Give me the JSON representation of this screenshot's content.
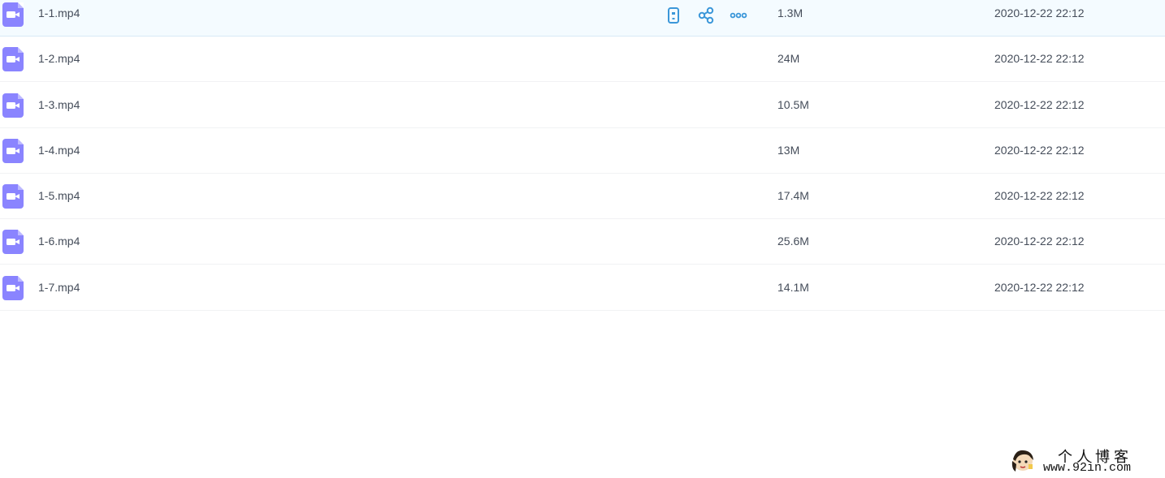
{
  "files": [
    {
      "name": "1-1.mp4",
      "size": "1.3M",
      "date": "2020-12-22 22:12"
    },
    {
      "name": "1-2.mp4",
      "size": "24M",
      "date": "2020-12-22 22:12"
    },
    {
      "name": "1-3.mp4",
      "size": "10.5M",
      "date": "2020-12-22 22:12"
    },
    {
      "name": "1-4.mp4",
      "size": "13M",
      "date": "2020-12-22 22:12"
    },
    {
      "name": "1-5.mp4",
      "size": "17.4M",
      "date": "2020-12-22 22:12"
    },
    {
      "name": "1-6.mp4",
      "size": "25.6M",
      "date": "2020-12-22 22:12"
    },
    {
      "name": "1-7.mp4",
      "size": "14.1M",
      "date": "2020-12-22 22:12"
    }
  ],
  "hover_actions": [
    "phone-icon",
    "share-icon",
    "more-icon"
  ],
  "file_icon": "video-file-icon",
  "colors": {
    "accent": "#3b97d9",
    "video_icon": "#8a84ff",
    "hover_row": "#f4fbff"
  },
  "watermark": {
    "title": "个人博客",
    "url": "www.92in.com"
  }
}
